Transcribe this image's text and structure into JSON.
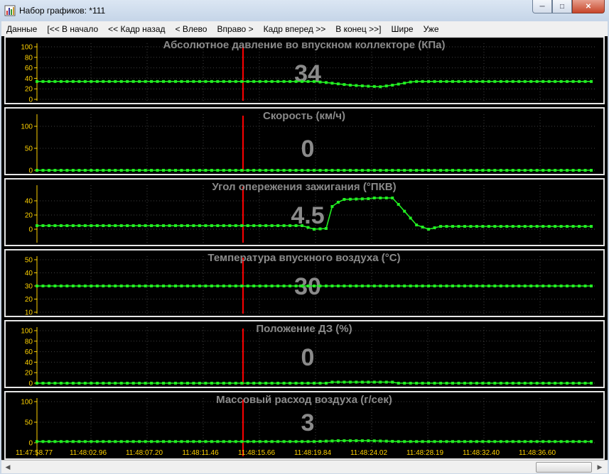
{
  "window": {
    "title": "Набор графиков: *111",
    "controls": [
      "minimize",
      "maximize",
      "close"
    ]
  },
  "menu": [
    "Данные",
    "[<< В начало",
    "<< Кадр назад",
    "< Влево",
    "Вправо >",
    "Кадр вперед >>",
    "В конец >>]",
    "Шире",
    "Уже"
  ],
  "colors": {
    "trace": "#22ee22",
    "cursor": "#ff0000",
    "ticks": "#ffd200",
    "title": "#8a8a8a",
    "grid": "#3f3f3f"
  },
  "cursor_index": 34,
  "time_labels": [
    "11:47:58.77",
    "11:48:02.96",
    "11:48:07.20",
    "11:48:11.46",
    "11:48:15.66",
    "11:48:19.84",
    "11:48:24.02",
    "11:48:28.19",
    "11:48:32.40",
    "11:48:36.60"
  ],
  "chart_data": [
    {
      "type": "line",
      "title": "Абсолютное давление во впускном коллекторе  (КПа)",
      "current_value": "34",
      "yticks": [
        "0",
        "20",
        "40",
        "60",
        "80",
        "100"
      ],
      "ylim": [
        0,
        100
      ],
      "keyframes": [
        [
          0,
          34
        ],
        [
          46,
          34
        ],
        [
          48,
          32
        ],
        [
          52,
          27
        ],
        [
          55,
          25
        ],
        [
          57,
          24
        ],
        [
          59,
          27
        ],
        [
          62,
          33
        ],
        [
          63,
          34
        ],
        [
          92,
          34
        ]
      ]
    },
    {
      "type": "line",
      "title": "Скорость  (км/ч)",
      "current_value": "0",
      "yticks": [
        "0",
        "50",
        "100"
      ],
      "ylim": [
        0,
        100
      ],
      "keyframes": [
        [
          0,
          0
        ],
        [
          92,
          0
        ]
      ]
    },
    {
      "type": "line",
      "title": "Угол опережения зажигания  (°ПКВ)",
      "current_value": "4.5",
      "yticks": [
        "0",
        "20",
        "40"
      ],
      "ylim": [
        -5,
        45
      ],
      "keyframes": [
        [
          0,
          5
        ],
        [
          44,
          5
        ],
        [
          46,
          0
        ],
        [
          48,
          1
        ],
        [
          49,
          32
        ],
        [
          50,
          38
        ],
        [
          51,
          42
        ],
        [
          55,
          43
        ],
        [
          56,
          44
        ],
        [
          59,
          44
        ],
        [
          60,
          35
        ],
        [
          63,
          6
        ],
        [
          65,
          0
        ],
        [
          67,
          4
        ],
        [
          92,
          4
        ]
      ]
    },
    {
      "type": "line",
      "title": "Температура впускного воздуха  (°C)",
      "current_value": "30",
      "yticks": [
        "10",
        "20",
        "30",
        "40",
        "50"
      ],
      "ylim": [
        10,
        50
      ],
      "keyframes": [
        [
          0,
          30
        ],
        [
          92,
          30
        ]
      ]
    },
    {
      "type": "line",
      "title": "Положение ДЗ  (%)",
      "current_value": "0",
      "yticks": [
        "0",
        "20",
        "40",
        "60",
        "80",
        "100"
      ],
      "ylim": [
        0,
        100
      ],
      "keyframes": [
        [
          0,
          0
        ],
        [
          48,
          0
        ],
        [
          49,
          2
        ],
        [
          59,
          2
        ],
        [
          60,
          0
        ],
        [
          92,
          0
        ]
      ]
    },
    {
      "type": "line",
      "title": "Массовый расход воздуха  (г/сек)",
      "current_value": "3",
      "yticks": [
        "0",
        "50",
        "100"
      ],
      "ylim": [
        0,
        100
      ],
      "keyframes": [
        [
          0,
          3
        ],
        [
          46,
          3
        ],
        [
          48,
          4
        ],
        [
          50,
          5
        ],
        [
          55,
          5
        ],
        [
          58,
          4
        ],
        [
          60,
          3
        ],
        [
          92,
          3
        ]
      ]
    }
  ]
}
